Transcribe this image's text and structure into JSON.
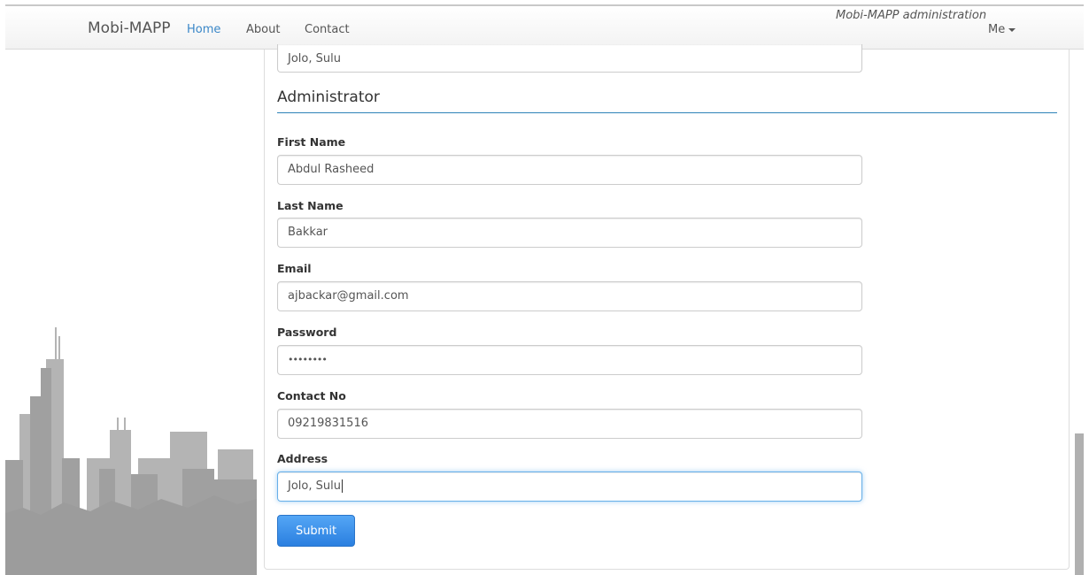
{
  "navbar": {
    "brand": "Mobi-MAPP",
    "links": [
      {
        "label": "Home",
        "active": true
      },
      {
        "label": "About",
        "active": false
      },
      {
        "label": "Contact",
        "active": false
      }
    ],
    "admin_title": "Mobi-MAPP administration",
    "user_menu": "Me"
  },
  "form": {
    "top_address_value": "Jolo, Sulu",
    "section_title": "Administrator",
    "fields": {
      "first_name": {
        "label": "First Name",
        "value": "Abdul Rasheed"
      },
      "last_name": {
        "label": "Last Name",
        "value": "Bakkar"
      },
      "email": {
        "label": "Email",
        "value": "ajbackar@gmail.com"
      },
      "password": {
        "label": "Password",
        "value": "••••••••"
      },
      "contact_no": {
        "label": "Contact No",
        "value": "09219831516"
      },
      "address": {
        "label": "Address",
        "value": "Jolo, Sulu"
      }
    },
    "submit_label": "Submit"
  },
  "colors": {
    "accent": "#3a87c8",
    "button": "#2a7fe0",
    "skyline": "#a0a0a0"
  }
}
